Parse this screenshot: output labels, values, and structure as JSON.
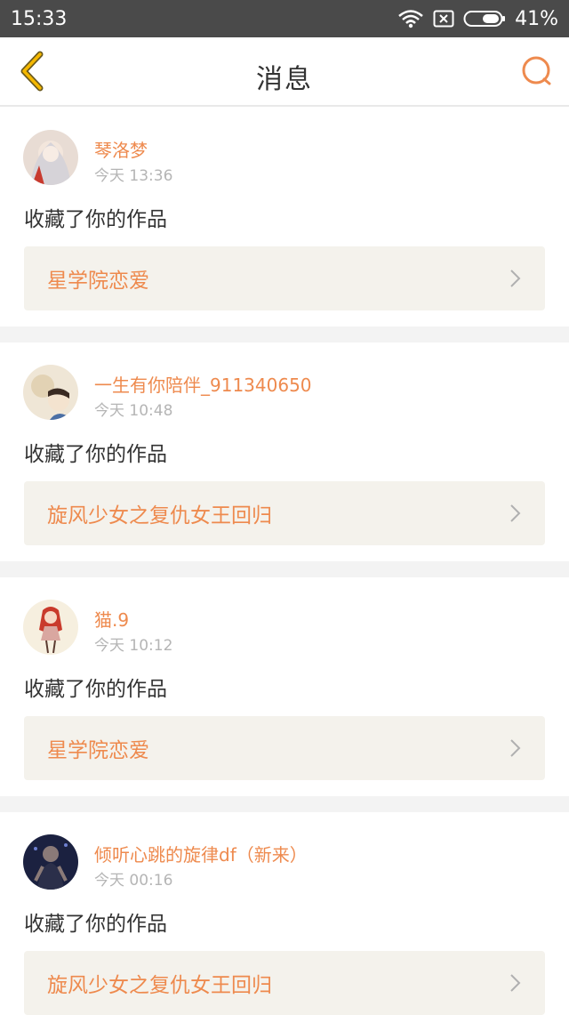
{
  "status_bar": {
    "time": "15:33",
    "battery": "41%",
    "icons": [
      "wifi-icon",
      "sim-icon",
      "battery-icon"
    ]
  },
  "header": {
    "title": "消息",
    "back_icon": "chevron-left-icon",
    "search_icon": "search-icon"
  },
  "colors": {
    "accent": "#ee8a4e",
    "back_icon_stroke": "#f5b800",
    "status_bar_bg": "#4a4a4a",
    "card_link_bg": "#f4f2ec"
  },
  "messages": [
    {
      "username": "琴洛梦",
      "timestamp": "今天 13:36",
      "action": "收藏了你的作品",
      "work_title": "星学院恋爱"
    },
    {
      "username": "一生有你陪伴_911340650",
      "timestamp": "今天 10:48",
      "action": "收藏了你的作品",
      "work_title": "旋风少女之复仇女王回归"
    },
    {
      "username": "猫.9",
      "timestamp": "今天 10:12",
      "action": "收藏了你的作品",
      "work_title": "星学院恋爱"
    },
    {
      "username": "倾听心跳的旋律df（新来）",
      "timestamp": "今天 00:16",
      "action": "收藏了你的作品",
      "work_title": "旋风少女之复仇女王回归"
    }
  ]
}
